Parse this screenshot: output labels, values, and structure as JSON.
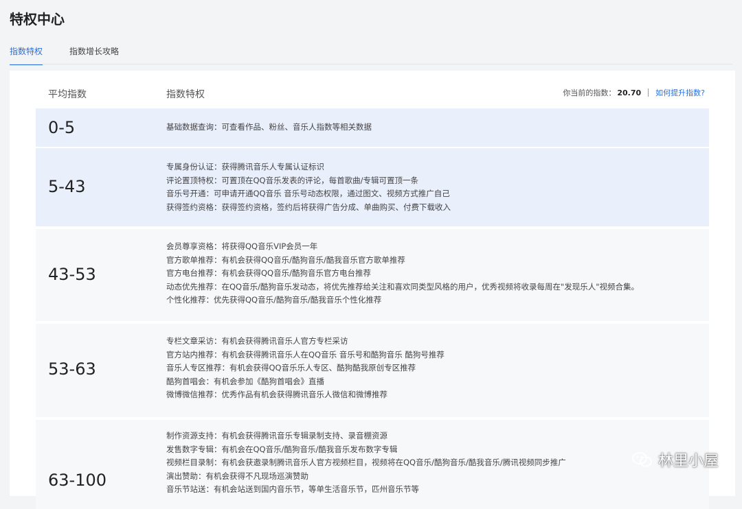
{
  "page": {
    "title": "特权中心"
  },
  "tabs": [
    {
      "label": "指数特权",
      "active": true
    },
    {
      "label": "指数增长攻略",
      "active": false
    }
  ],
  "table": {
    "header": {
      "col_range": "平均指数",
      "col_privileges": "指数特权",
      "current_label": "你当前的指数：",
      "current_value": "20.70",
      "improve_link": "如何提升指数?"
    },
    "tiers": [
      {
        "range": "0-5",
        "items": [
          "基础数据查询：可查看作品、粉丝、音乐人指数等相关数据"
        ]
      },
      {
        "range": "5-43",
        "items": [
          "专属身份认证：获得腾讯音乐人专属认证标识",
          "评论置顶特权：可置顶在QQ音乐发表的评论，每首歌曲/专辑可置顶一条",
          "音乐号开通：可申请开通QQ音乐 音乐号动态权限，通过图文、视频方式推广自己",
          "获得签约资格：获得签约资格，签约后将获得广告分成、单曲购买、付费下载收入"
        ]
      },
      {
        "range": "43-53",
        "items": [
          "会员尊享资格：将获得QQ音乐VIP会员一年",
          "官方歌单推荐：有机会获得QQ音乐/酷狗音乐/酷我音乐官方歌单推荐",
          "官方电台推荐：有机会获得QQ音乐/酷狗音乐官方电台推荐",
          "动态优先推荐：在QQ音乐/酷狗音乐发动态，将优先推荐给关注和喜欢同类型风格的用户，优秀视频将收录每周在\"发现乐人\"视频合集。",
          "个性化推荐：优先获得QQ音乐/酷狗音乐/酷我音乐个性化推荐"
        ]
      },
      {
        "range": "53-63",
        "items": [
          "专栏文章采访：有机会获得腾讯音乐人官方专栏采访",
          "官方站内推荐：有机会获得腾讯音乐人在QQ音乐 音乐号和酷狗音乐 酷狗号推荐",
          "音乐人专区推荐：有机会获得QQ音乐乐人专区、酷狗酷我原创专区推荐",
          "酷狗首唱会：有机会参加《酷狗首唱会》直播",
          "微博微信推荐：优秀作品有机会获得腾讯音乐人微信和微博推荐"
        ]
      },
      {
        "range": "63-100",
        "items": [
          "制作资源支持：有机会获得腾讯音乐专辑录制支持、录音棚资源",
          "发售数字专辑：有机会在QQ音乐/酷狗音乐/酷我音乐发布数字专辑",
          "视频栏目录制：有机会获邀录制腾讯音乐人官方视频栏目，视频将在QQ音乐/酷狗音乐/酷我音乐/腾讯视频同步推广",
          "演出赞助：有机会获得不凡现场巡演赞助",
          "音乐节站送：有机会站送到国内音乐节，等单生活音乐节，匹州音乐节等"
        ]
      }
    ]
  },
  "watermark": {
    "text": "林里小屋",
    "icon": "wechat-icon"
  }
}
